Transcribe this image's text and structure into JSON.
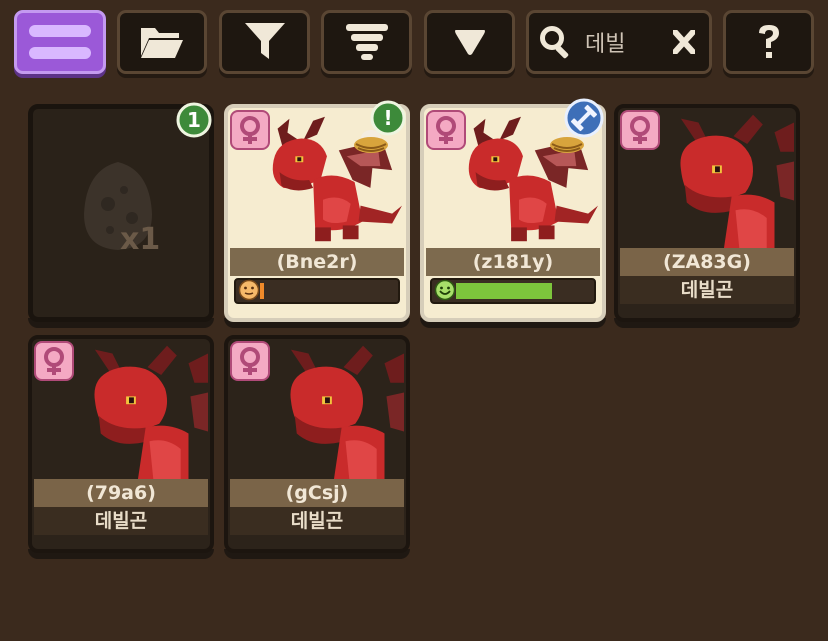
{
  "toolbar": {
    "search_value": "데빌"
  },
  "egg_card": {
    "badge": "1",
    "count": "x1"
  },
  "dragons": [
    {
      "id_label": "(Bne2r)",
      "status": "alert",
      "status_badge": "!",
      "progress": 0.03,
      "mood": "neutral",
      "mood_color": "#f08a2a"
    },
    {
      "id_label": "(z181y)",
      "status": "training",
      "progress": 0.72,
      "mood": "happy",
      "mood_color": "#7dc53c"
    },
    {
      "id_label": "(ZA83G)",
      "name": "데빌곤"
    },
    {
      "id_label": "(79a6)",
      "name": "데빌곤"
    },
    {
      "id_label": "(gCsj)",
      "name": "데빌곤"
    }
  ],
  "colors": {
    "menu_accent": "#9b59d8",
    "badge_green": "#3d8a3a",
    "badge_blue": "#3e6fb8",
    "gender_pink": "#e27fa6"
  }
}
